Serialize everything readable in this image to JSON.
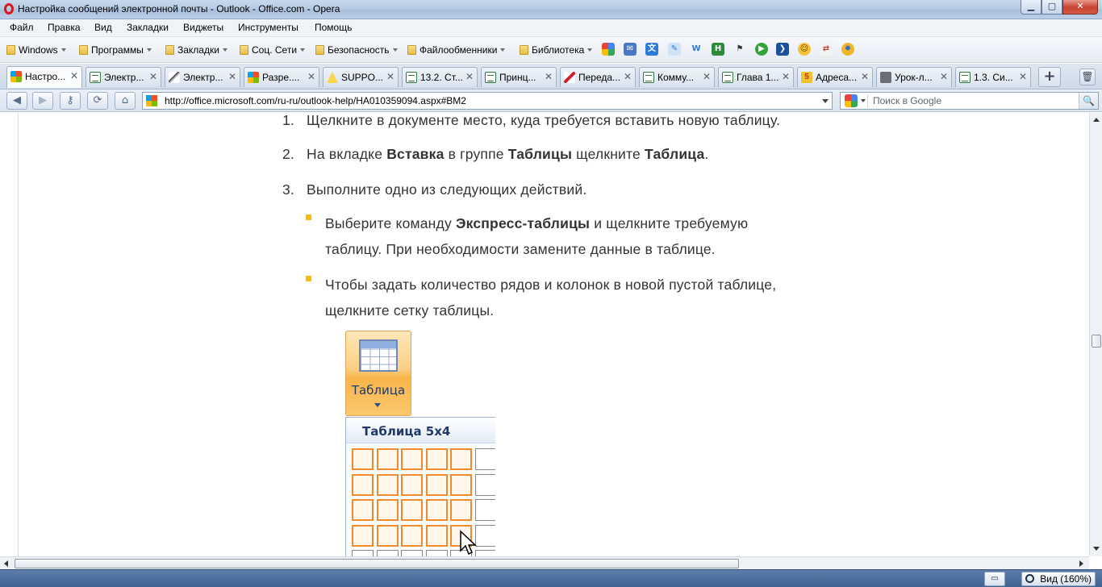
{
  "window": {
    "title": "Настройка сообщений электронной почты - Outlook - Office.com - Opera",
    "buttons": {
      "minimize": "▁",
      "maximize": "▢",
      "close": "✕"
    }
  },
  "menubar": {
    "items": [
      "Файл",
      "Правка",
      "Вид",
      "Закладки",
      "Виджеты",
      "Инструменты",
      "Помощь"
    ]
  },
  "bookmarks": {
    "folders": [
      "Windows",
      "Программы",
      "Закладки",
      "Соц. Сети",
      "Безопасность",
      "Файлообменники",
      "Библиотека"
    ],
    "icons": [
      "google-icon",
      "mail-icon",
      "translate-icon",
      "pencil-icon",
      "w-icon",
      "h-icon",
      "flag-icon",
      "play-icon",
      "arrow-icon",
      "smiley-icon",
      "tool-icon",
      "gear-icon"
    ]
  },
  "tabs": [
    {
      "label": "Настро...",
      "icon": "ms",
      "active": true
    },
    {
      "label": "Электр...",
      "icon": "doc"
    },
    {
      "label": "Электр...",
      "icon": "plane"
    },
    {
      "label": "Разре....",
      "icon": "ms"
    },
    {
      "label": "SUPPO...",
      "icon": "warn"
    },
    {
      "label": "13.2. Ст...",
      "icon": "doc"
    },
    {
      "label": "Принц...",
      "icon": "doc"
    },
    {
      "label": "Переда...",
      "icon": "red"
    },
    {
      "label": "Комму...",
      "icon": "doc"
    },
    {
      "label": "Глава 1...",
      "icon": "doc"
    },
    {
      "label": "Адреса...",
      "icon": "5"
    },
    {
      "label": "Урок-л...",
      "icon": "gray"
    },
    {
      "label": "1.3. Си...",
      "icon": "doc"
    }
  ],
  "newtab_label": "+",
  "address": {
    "url": "http://office.microsoft.com/ru-ru/outlook-help/HA010359094.aspx#BM2",
    "search_placeholder": "Поиск в Google"
  },
  "content": {
    "steps": [
      {
        "num": "1.",
        "text": "Щелкните в документе место, куда требуется вставить новую таблицу."
      },
      {
        "num": "2.",
        "pre": "На вкладке ",
        "b1": "Вставка",
        "mid": " в группе ",
        "b2": "Таблицы",
        "mid2": " щелкните ",
        "b3": "Таблица",
        "post": "."
      },
      {
        "num": "3.",
        "text": "Выполните одно из следующих действий."
      }
    ],
    "bullets": [
      {
        "pre": "Выберите команду ",
        "bold": "Экспресс-таблицы",
        "post": " и щелкните требуемую",
        "line2": "таблицу. При необходимости замените данные в таблице."
      },
      {
        "line1": "Чтобы задать количество рядов и колонок в новой пустой таблице,",
        "line2": "щелкните сетку таблицы."
      }
    ],
    "illustration": {
      "button_label": "Таблица",
      "grid_title": "Таблица 5x4"
    }
  },
  "statusbar": {
    "zoom": "Вид (160%)"
  },
  "colors": {
    "bullet": "#f9bb00",
    "grid_highlight": "#f08a2c",
    "statusbar": "#4a6b99"
  }
}
